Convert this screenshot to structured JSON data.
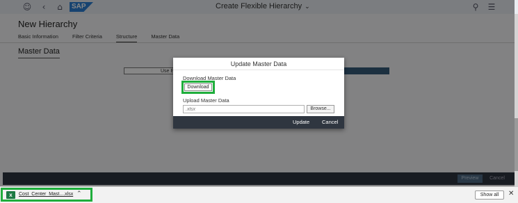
{
  "shell": {
    "title": "Create Flexible Hierarchy",
    "icons": [
      "user-icon",
      "back-icon",
      "home-icon",
      "search-icon",
      "menu-icon"
    ],
    "logo": "SAP"
  },
  "page": {
    "object_title": "New Hierarchy",
    "tabs": [
      {
        "label": "Basic Information"
      },
      {
        "label": "Filter Criteria"
      },
      {
        "label": "Structure"
      },
      {
        "label": "Master Data"
      }
    ],
    "section_title": "Master Data",
    "bg_left_button": "Use E",
    "footer_primary": "Preview",
    "footer_secondary": "Cancel"
  },
  "dialog": {
    "title": "Update Master Data",
    "download_label": "Download Master Data",
    "download_button": "Download",
    "upload_label": "Upload Master Data",
    "upload_placeholder": ".xlsx",
    "browse_button": "Browse...",
    "update_button": "Update",
    "cancel_button": "Cancel"
  },
  "download_bar": {
    "filename": "Cost_Center_Mast....xlsx",
    "show_all": "Show all",
    "close": "✕",
    "file_icon": "excel-file-icon"
  },
  "colors": {
    "highlight": "#1fae3c",
    "sap_blue": "#2d7fd3",
    "footer_dark": "#2f3640"
  }
}
